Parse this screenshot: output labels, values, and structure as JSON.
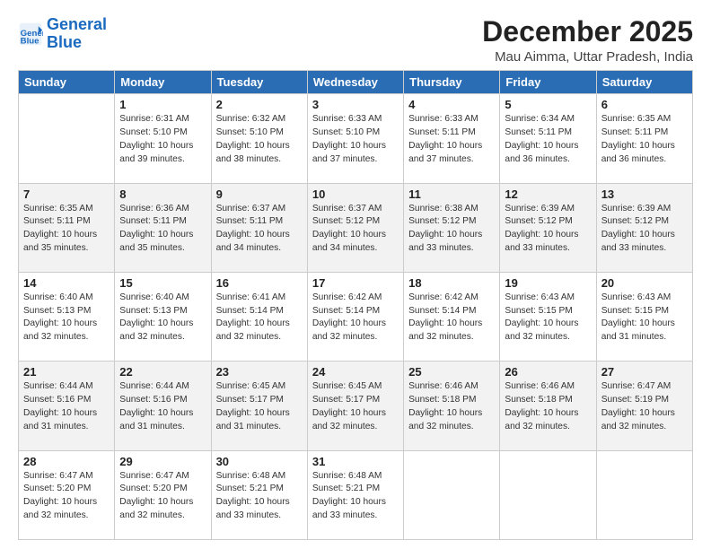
{
  "logo": {
    "line1": "General",
    "line2": "Blue"
  },
  "title": "December 2025",
  "subtitle": "Mau Aimma, Uttar Pradesh, India",
  "days_of_week": [
    "Sunday",
    "Monday",
    "Tuesday",
    "Wednesday",
    "Thursday",
    "Friday",
    "Saturday"
  ],
  "weeks": [
    [
      {
        "day": "",
        "info": ""
      },
      {
        "day": "1",
        "info": "Sunrise: 6:31 AM\nSunset: 5:10 PM\nDaylight: 10 hours\nand 39 minutes."
      },
      {
        "day": "2",
        "info": "Sunrise: 6:32 AM\nSunset: 5:10 PM\nDaylight: 10 hours\nand 38 minutes."
      },
      {
        "day": "3",
        "info": "Sunrise: 6:33 AM\nSunset: 5:10 PM\nDaylight: 10 hours\nand 37 minutes."
      },
      {
        "day": "4",
        "info": "Sunrise: 6:33 AM\nSunset: 5:11 PM\nDaylight: 10 hours\nand 37 minutes."
      },
      {
        "day": "5",
        "info": "Sunrise: 6:34 AM\nSunset: 5:11 PM\nDaylight: 10 hours\nand 36 minutes."
      },
      {
        "day": "6",
        "info": "Sunrise: 6:35 AM\nSunset: 5:11 PM\nDaylight: 10 hours\nand 36 minutes."
      }
    ],
    [
      {
        "day": "7",
        "info": "Sunrise: 6:35 AM\nSunset: 5:11 PM\nDaylight: 10 hours\nand 35 minutes."
      },
      {
        "day": "8",
        "info": "Sunrise: 6:36 AM\nSunset: 5:11 PM\nDaylight: 10 hours\nand 35 minutes."
      },
      {
        "day": "9",
        "info": "Sunrise: 6:37 AM\nSunset: 5:11 PM\nDaylight: 10 hours\nand 34 minutes."
      },
      {
        "day": "10",
        "info": "Sunrise: 6:37 AM\nSunset: 5:12 PM\nDaylight: 10 hours\nand 34 minutes."
      },
      {
        "day": "11",
        "info": "Sunrise: 6:38 AM\nSunset: 5:12 PM\nDaylight: 10 hours\nand 33 minutes."
      },
      {
        "day": "12",
        "info": "Sunrise: 6:39 AM\nSunset: 5:12 PM\nDaylight: 10 hours\nand 33 minutes."
      },
      {
        "day": "13",
        "info": "Sunrise: 6:39 AM\nSunset: 5:12 PM\nDaylight: 10 hours\nand 33 minutes."
      }
    ],
    [
      {
        "day": "14",
        "info": "Sunrise: 6:40 AM\nSunset: 5:13 PM\nDaylight: 10 hours\nand 32 minutes."
      },
      {
        "day": "15",
        "info": "Sunrise: 6:40 AM\nSunset: 5:13 PM\nDaylight: 10 hours\nand 32 minutes."
      },
      {
        "day": "16",
        "info": "Sunrise: 6:41 AM\nSunset: 5:14 PM\nDaylight: 10 hours\nand 32 minutes."
      },
      {
        "day": "17",
        "info": "Sunrise: 6:42 AM\nSunset: 5:14 PM\nDaylight: 10 hours\nand 32 minutes."
      },
      {
        "day": "18",
        "info": "Sunrise: 6:42 AM\nSunset: 5:14 PM\nDaylight: 10 hours\nand 32 minutes."
      },
      {
        "day": "19",
        "info": "Sunrise: 6:43 AM\nSunset: 5:15 PM\nDaylight: 10 hours\nand 32 minutes."
      },
      {
        "day": "20",
        "info": "Sunrise: 6:43 AM\nSunset: 5:15 PM\nDaylight: 10 hours\nand 31 minutes."
      }
    ],
    [
      {
        "day": "21",
        "info": "Sunrise: 6:44 AM\nSunset: 5:16 PM\nDaylight: 10 hours\nand 31 minutes."
      },
      {
        "day": "22",
        "info": "Sunrise: 6:44 AM\nSunset: 5:16 PM\nDaylight: 10 hours\nand 31 minutes."
      },
      {
        "day": "23",
        "info": "Sunrise: 6:45 AM\nSunset: 5:17 PM\nDaylight: 10 hours\nand 31 minutes."
      },
      {
        "day": "24",
        "info": "Sunrise: 6:45 AM\nSunset: 5:17 PM\nDaylight: 10 hours\nand 32 minutes."
      },
      {
        "day": "25",
        "info": "Sunrise: 6:46 AM\nSunset: 5:18 PM\nDaylight: 10 hours\nand 32 minutes."
      },
      {
        "day": "26",
        "info": "Sunrise: 6:46 AM\nSunset: 5:18 PM\nDaylight: 10 hours\nand 32 minutes."
      },
      {
        "day": "27",
        "info": "Sunrise: 6:47 AM\nSunset: 5:19 PM\nDaylight: 10 hours\nand 32 minutes."
      }
    ],
    [
      {
        "day": "28",
        "info": "Sunrise: 6:47 AM\nSunset: 5:20 PM\nDaylight: 10 hours\nand 32 minutes."
      },
      {
        "day": "29",
        "info": "Sunrise: 6:47 AM\nSunset: 5:20 PM\nDaylight: 10 hours\nand 32 minutes."
      },
      {
        "day": "30",
        "info": "Sunrise: 6:48 AM\nSunset: 5:21 PM\nDaylight: 10 hours\nand 33 minutes."
      },
      {
        "day": "31",
        "info": "Sunrise: 6:48 AM\nSunset: 5:21 PM\nDaylight: 10 hours\nand 33 minutes."
      },
      {
        "day": "",
        "info": ""
      },
      {
        "day": "",
        "info": ""
      },
      {
        "day": "",
        "info": ""
      }
    ]
  ]
}
